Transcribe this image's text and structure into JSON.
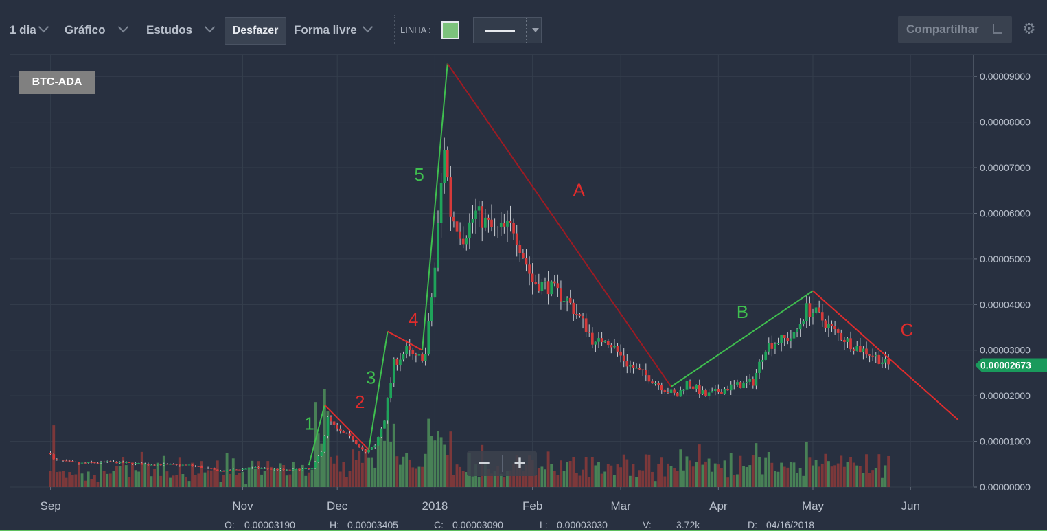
{
  "toolbar": {
    "interval": "1 dia",
    "chart_menu": "Gráfico",
    "studies_menu": "Estudos",
    "undo_label": "Desfazer",
    "draw_menu": "Forma livre",
    "line_label": "LINHA :",
    "line_color": "#7cc27c",
    "share_label": "Compartilhar"
  },
  "icons": {
    "share": "share-icon",
    "settings": "gear-icon",
    "chevron": "chevron-down-icon"
  },
  "pair": "BTC-ADA",
  "zoom": {
    "out": "−",
    "in": "+"
  },
  "ohlc": {
    "o_label": "O:",
    "o_value": "0.00003190",
    "h_label": "H:",
    "h_value": "0.00003405",
    "c_label": "C:",
    "c_value": "0.00003090",
    "l_label": "L:",
    "l_value": "0.00003030",
    "v_label": "V:",
    "v_value": "3.72k",
    "d_label": "D:",
    "d_value": "04/16/2018"
  },
  "chart_data": {
    "type": "candlestick",
    "symbol": "BTC-ADA",
    "interval": "1 dia",
    "x_ticks": [
      "Sep",
      "Nov",
      "Dec",
      "2018",
      "Feb",
      "Mar",
      "Apr",
      "May",
      "Jun"
    ],
    "x_tick_dates": [
      "2017-09-01",
      "2017-11-01",
      "2017-12-01",
      "2018-01-01",
      "2018-02-01",
      "2018-03-01",
      "2018-04-01",
      "2018-05-01",
      "2018-06-01"
    ],
    "y_ticks": [
      "0.00000000",
      "0.00001000",
      "0.00002000",
      "0.00003000",
      "0.00004000",
      "0.00005000",
      "0.00006000",
      "0.00007000",
      "0.00008000",
      "0.00009000"
    ],
    "ylim": [
      0,
      9.47e-05
    ],
    "xlim": [
      "2017-08-19",
      "2018-06-21"
    ],
    "last_price": "0.00002673",
    "last_price_value": 2.673e-05,
    "grid": true,
    "close_path": [
      [
        "2017-09-01",
        7.5e-06
      ],
      [
        "2017-09-02",
        6e-06
      ],
      [
        "2017-09-10",
        5.2e-06
      ],
      [
        "2017-09-20",
        5.5e-06
      ],
      [
        "2017-10-01",
        5e-06
      ],
      [
        "2017-10-15",
        4.8e-06
      ],
      [
        "2017-10-25",
        3.5e-06
      ],
      [
        "2017-11-05",
        4.2e-06
      ],
      [
        "2017-11-15",
        3.7e-06
      ],
      [
        "2017-11-23",
        4e-06
      ],
      [
        "2017-11-26",
        8e-06
      ],
      [
        "2017-11-28",
        1.5e-05
      ],
      [
        "2017-12-01",
        1.25e-05
      ],
      [
        "2017-12-06",
        1.05e-05
      ],
      [
        "2017-12-10",
        7.5e-06
      ],
      [
        "2017-12-13",
        9e-06
      ],
      [
        "2017-12-16",
        1.5e-05
      ],
      [
        "2017-12-19",
        2.7e-05
      ],
      [
        "2017-12-23",
        3e-05
      ],
      [
        "2017-12-26",
        2.8e-05
      ],
      [
        "2017-12-29",
        2.9e-05
      ],
      [
        "2018-01-01",
        4.8e-05
      ],
      [
        "2018-01-04",
        7.5e-05
      ],
      [
        "2018-01-06",
        6e-05
      ],
      [
        "2018-01-10",
        5.5e-05
      ],
      [
        "2018-01-14",
        6e-05
      ],
      [
        "2018-01-20",
        5.6e-05
      ],
      [
        "2018-01-26",
        5.7e-05
      ],
      [
        "2018-02-01",
        4.5e-05
      ],
      [
        "2018-02-06",
        4.4e-05
      ],
      [
        "2018-02-12",
        4.1e-05
      ],
      [
        "2018-02-18",
        3.5e-05
      ],
      [
        "2018-02-21",
        3.1e-05
      ],
      [
        "2018-02-24",
        3.3e-05
      ],
      [
        "2018-03-03",
        2.7e-05
      ],
      [
        "2018-03-10",
        2.4e-05
      ],
      [
        "2018-03-16",
        2.1e-05
      ],
      [
        "2018-03-19",
        2e-05
      ],
      [
        "2018-03-22",
        2.3e-05
      ],
      [
        "2018-03-28",
        2e-05
      ],
      [
        "2018-04-05",
        2.2e-05
      ],
      [
        "2018-04-12",
        2.3e-05
      ],
      [
        "2018-04-16",
        3.09e-05
      ],
      [
        "2018-04-20",
        3.2e-05
      ],
      [
        "2018-04-25",
        3.3e-05
      ],
      [
        "2018-04-29",
        3.9e-05
      ],
      [
        "2018-05-02",
        3.8e-05
      ],
      [
        "2018-05-08",
        3.4e-05
      ],
      [
        "2018-05-14",
        3.1e-05
      ],
      [
        "2018-05-20",
        2.9e-05
      ],
      [
        "2018-05-25",
        2.67e-05
      ]
    ],
    "volume_scale": "relative",
    "drawings": [
      {
        "label": "1",
        "color": "#3fbf4f",
        "points": [
          [
            "2017-11-22",
            4.8e-06
          ],
          [
            "2017-11-27",
            1.8e-05
          ]
        ]
      },
      {
        "label": "2",
        "color": "#e02c2c",
        "points": [
          [
            "2017-11-27",
            1.8e-05
          ],
          [
            "2017-12-11",
            8.2e-06
          ]
        ]
      },
      {
        "label": "3",
        "color": "#3fbf4f",
        "points": [
          [
            "2017-12-11",
            8.2e-06
          ],
          [
            "2017-12-17",
            3.41e-05
          ]
        ]
      },
      {
        "label": "4",
        "color": "#e02c2c",
        "points": [
          [
            "2017-12-17",
            3.41e-05
          ],
          [
            "2017-12-28",
            3e-05
          ]
        ]
      },
      {
        "label": "5",
        "color": "#3fbf4f",
        "points": [
          [
            "2017-12-28",
            3e-05
          ],
          [
            "2018-01-05",
            9.28e-05
          ]
        ]
      },
      {
        "label": "A",
        "color": "#9e1b23",
        "points": [
          [
            "2018-01-05",
            9.28e-05
          ],
          [
            "2018-03-17",
            2.2e-05
          ]
        ]
      },
      {
        "label": "B",
        "color": "#3fbf4f",
        "points": [
          [
            "2018-03-17",
            2.2e-05
          ],
          [
            "2018-05-01",
            4.3e-05
          ]
        ]
      },
      {
        "label": "C",
        "color": "#e02c2c",
        "points": [
          [
            "2018-05-01",
            4.3e-05
          ],
          [
            "2018-06-16",
            1.48e-05
          ]
        ]
      }
    ],
    "colors": {
      "up": "#1fa35a",
      "down": "#d63a3a",
      "volume_up": "#4d8f5a",
      "volume_down": "#8b3a3a",
      "price_line": "#2fa66a"
    }
  }
}
